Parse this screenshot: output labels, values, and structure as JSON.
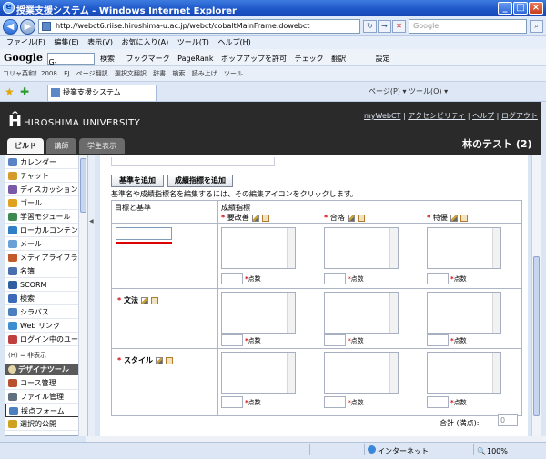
{
  "window": {
    "title": "授業支援システム - Windows Internet Explorer",
    "minimize": "_",
    "maximize": "□",
    "close": "×"
  },
  "address": {
    "url": "http://webct6.riise.hiroshima-u.ac.jp/webct/cobaltMainFrame.dowebct",
    "search_placeholder": "Google"
  },
  "menu": [
    "ファイル(F)",
    "編集(E)",
    "表示(V)",
    "お気に入り(A)",
    "ツール(T)",
    "ヘルプ(H)"
  ],
  "google_bar": {
    "logo": "Google",
    "g_field": "G-",
    "items": [
      "検索",
      "ブックマーク",
      "PageRank",
      "ポップアップを許可",
      "チェック",
      "翻訳",
      "設定"
    ]
  },
  "links_bar": [
    "コリャ英和！2008",
    "EJ",
    "ページ翻訳",
    "選択文翻訳",
    "辞書",
    "検索",
    "読み上げ",
    "ツール"
  ],
  "favorites": {
    "tab_title": "授業支援システム",
    "right_tools": "ページ(P) ▾  ツール(O) ▾"
  },
  "header": {
    "university": "HIROSHIMA UNIVERSITY",
    "logo_glyph": "Ĥ",
    "links": [
      "myWebCT",
      "アクセシビリティ",
      "ヘルプ",
      "ログアウト"
    ],
    "course_title": "林のテスト (2)",
    "tabs": [
      "ビルド",
      "講師",
      "学生表示"
    ]
  },
  "sidebar": {
    "items": [
      {
        "label": "カレンダー",
        "color": "#5b84c6"
      },
      {
        "label": "チャット",
        "color": "#d69a2a"
      },
      {
        "label": "ディスカッション",
        "color": "#7a5aa8"
      },
      {
        "label": "ゴール",
        "color": "#e0a020"
      },
      {
        "label": "学習モジュール",
        "color": "#3b8a50"
      },
      {
        "label": "ローカルコンテンツ",
        "color": "#2e7fc8"
      },
      {
        "label": "メール",
        "color": "#6aa0d8"
      },
      {
        "label": "メディアライブラリ",
        "color": "#c25a2a"
      },
      {
        "label": "名簿",
        "color": "#4a6fb0"
      },
      {
        "label": "SCORM",
        "color": "#2f5fa0"
      },
      {
        "label": "検索",
        "color": "#3a6ab8"
      },
      {
        "label": "シラバス",
        "color": "#4c7fbf"
      },
      {
        "label": "Web リンク",
        "color": "#3b8fd0"
      },
      {
        "label": "ログイン中のユーザ",
        "color": "#c04040"
      }
    ],
    "note": "(H) = 非表示",
    "section_title": "デザイナツール",
    "tools": [
      {
        "label": "コース管理",
        "color": "#b85030"
      },
      {
        "label": "ファイル管理",
        "color": "#607080"
      },
      {
        "label": "採点フォーム",
        "color": "#4a7fc0",
        "selected": true
      },
      {
        "label": "選択的公開",
        "color": "#d0a020"
      }
    ]
  },
  "main": {
    "buttons": [
      "基準を追加",
      "成績指標を追加"
    ],
    "instruction": "基準名や成績指標名を編集するには、その編集アイコンをクリックします。",
    "col_header_criteria": "目標と基準",
    "col_header_levels": "成績指標",
    "levels": [
      "要改善",
      "合格",
      "特優"
    ],
    "criteria": [
      "文法",
      "スタイル"
    ],
    "points_label": "点数",
    "total_label": "合計 (満点):",
    "total_value": "0"
  },
  "status": {
    "zone": "インターネット",
    "zoom": "100%"
  }
}
